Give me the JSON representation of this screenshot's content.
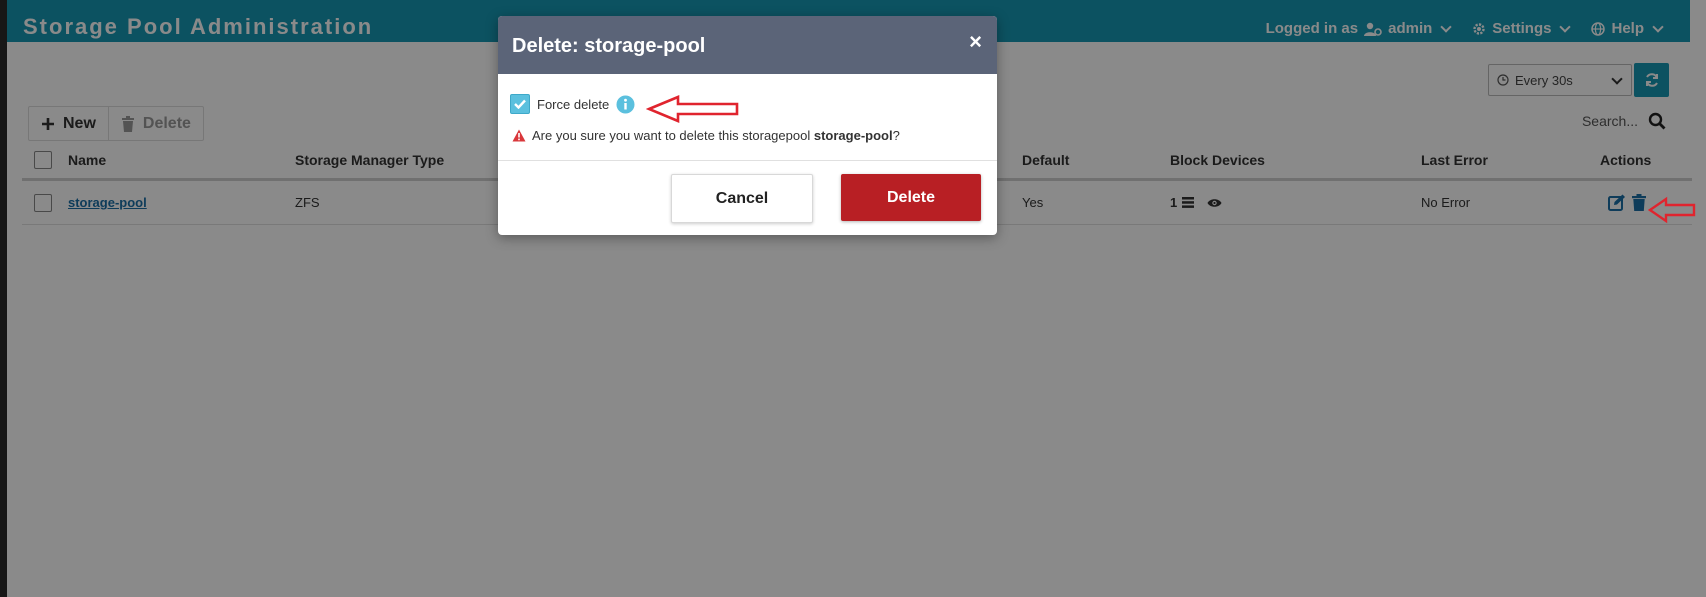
{
  "header": {
    "title": "Storage Pool Administration",
    "logged_in_label": "Logged in as",
    "user": "admin",
    "settings": "Settings",
    "help": "Help"
  },
  "toolbar": {
    "new_label": "New",
    "delete_label": "Delete",
    "refresh_interval": "Every 30s",
    "search_placeholder": "Search..."
  },
  "table": {
    "columns": {
      "name": "Name",
      "storage_manager_type": "Storage Manager Type",
      "default": "Default",
      "block_devices": "Block Devices",
      "last_error": "Last Error",
      "actions": "Actions"
    },
    "rows": [
      {
        "name": "storage-pool",
        "storage_manager_type": "ZFS",
        "default": "Yes",
        "block_devices": "1",
        "last_error": "No Error"
      }
    ]
  },
  "modal": {
    "title": "Delete: storage-pool",
    "close": "×",
    "force_delete_label": "Force delete",
    "force_delete_checked": true,
    "warning_prefix": "Are you sure you want to delete this storagepool",
    "warning_target": "storage-pool",
    "warning_suffix": "?",
    "cancel_label": "Cancel",
    "delete_label": "Delete"
  },
  "colors": {
    "header_bg": "#1798b3",
    "modal_header_bg": "#5b6478",
    "delete_button": "#b81f24",
    "checkbox_checked": "#5bc0de",
    "annotation_arrow": "#e0242e"
  },
  "icons": [
    "user-cog-icon",
    "gear-icon",
    "globe-icon",
    "clock-icon",
    "refresh-icon",
    "plus-icon",
    "trash-icon",
    "search-icon",
    "info-icon",
    "warning-icon",
    "edit-icon",
    "list-icon",
    "eye-icon",
    "check-icon",
    "close-icon"
  ]
}
